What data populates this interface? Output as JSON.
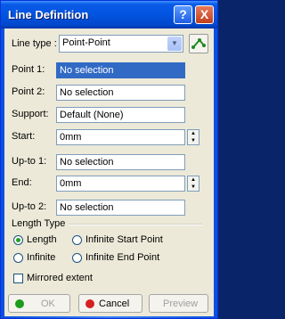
{
  "window": {
    "title": "Line Definition",
    "help_label": "?",
    "close_label": "X"
  },
  "line_type": {
    "label": "Line type :",
    "value": "Point-Point"
  },
  "fields": {
    "point1": {
      "label": "Point 1:",
      "value": "No selection"
    },
    "point2": {
      "label": "Point 2:",
      "value": "No selection"
    },
    "support": {
      "label": "Support:",
      "value": "Default (None)"
    },
    "start": {
      "label": "Start:",
      "value": "0mm"
    },
    "upto1": {
      "label": "Up-to 1:",
      "value": "No selection"
    },
    "end": {
      "label": "End:",
      "value": "0mm"
    },
    "upto2": {
      "label": "Up-to 2:",
      "value": "No selection"
    }
  },
  "length_type": {
    "title": "Length Type",
    "options": [
      "Length",
      "Infinite Start Point",
      "Infinite",
      "Infinite End Point"
    ],
    "selected": "Length"
  },
  "mirrored": {
    "label": "Mirrored extent",
    "checked": false
  },
  "buttons": {
    "ok": "OK",
    "cancel": "Cancel",
    "preview": "Preview"
  },
  "colors": {
    "selection": "#316ac5",
    "title_bar": "#0254e0",
    "ok_dot": "#1d9c1d",
    "cancel_dot": "#d62020"
  }
}
